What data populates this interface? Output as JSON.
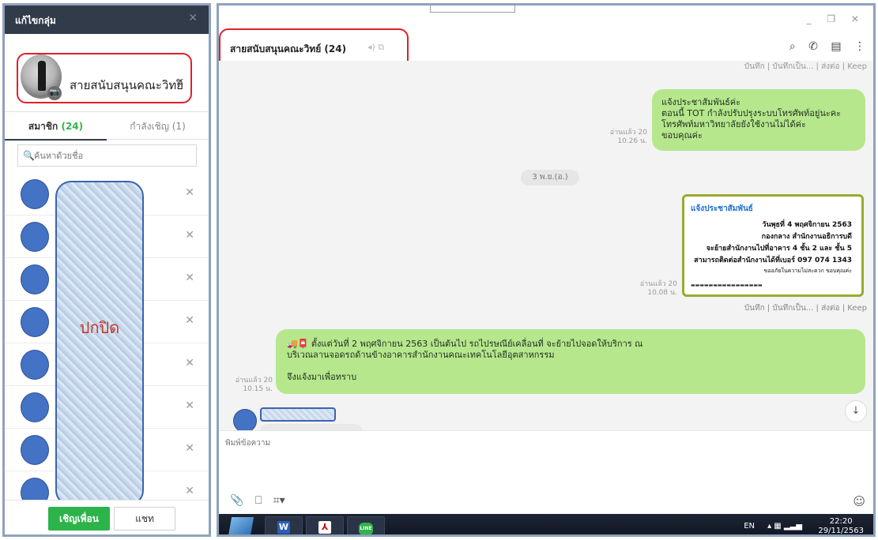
{
  "left_panel": {
    "title": "แก้ไขกลุ่ม",
    "close": "✕",
    "group_name": "สายสนับสนุนคณะวิทย์",
    "tabs": {
      "members_label": "สมาชิก",
      "members_count": "(24)",
      "invited_label": "กำลังเชิญ (1)"
    },
    "search_placeholder": "ค้นหาด้วยชื่อ",
    "remove_glyph": "✕",
    "mask_label": "ปกปิด",
    "invite_button": "เชิญเพื่อน",
    "chat_button": "แชท"
  },
  "chat": {
    "title": "สายสนับสนุนคณะวิทย์ (24)",
    "window_controls": "_ ❐ ✕",
    "top_actions": "บันทึก | บันทึกเป็น... | ส่งต่อ | Keep",
    "msg1": {
      "lines": [
        "แจ้งประชาสัมพันธ์ค่ะ",
        "ตอนนี้ TOT กำลังปรับปรุงระบบโทรศัพท์อยู่นะคะ",
        "โทรศัพท์มหาวิทยาลัยยังใช้งานไม่ได้ค่ะ",
        "ขอบคุณค่ะ"
      ],
      "read": "อ่านแล้ว 20",
      "time": "10.26 น."
    },
    "date_divider": "3 พ.ย.(อ.)",
    "image_msg": {
      "heading": "แจ้งประชาสัมพันธ์",
      "lines": [
        "วันพุธที่ 4 พฤศจิกายน 2563",
        "กองกลาง สำนักงานอธิการบดี",
        "จะย้ายสำนักงานไปที่อาคาร 4 ชั้น 2 และ ชั้น 5",
        "สามารถติดต่อสำนักงานได้ที่เบอร์ 097 074 1343",
        "ขออภัยในความไม่สะดวก ขอบคุณค่ะ"
      ],
      "read": "อ่านแล้ว 20",
      "time": "10.08 น.",
      "actions": "บันทึก | บันทึกเป็น... | ส่งต่อ | Keep"
    },
    "msg2": {
      "lines": [
        "🚚📮 ตั้งแต่วันที่ 2 พฤศจิกายน 2563 เป็นต้นไป รถไปรษณีย์เคลื่อนที่ จะย้ายไปจอดให้บริการ ณ",
        "บริเวณลานจอดรถด้านข้างอาคารสำนักงานคณะเทคโนโลยีอุตสาหกรรม",
        "",
        "จึงแจ้งมาเพื่อทราบ"
      ],
      "read": "อ่านแล้ว 20",
      "time": "10.15 น."
    },
    "input_placeholder": "พิมพ์ข้อความ",
    "scroll_down": "↓"
  },
  "taskbar": {
    "word": "W",
    "pdf": "⅄",
    "line": "LINE",
    "lang": "EN",
    "time": "22:20",
    "date": "29/11/2563"
  }
}
